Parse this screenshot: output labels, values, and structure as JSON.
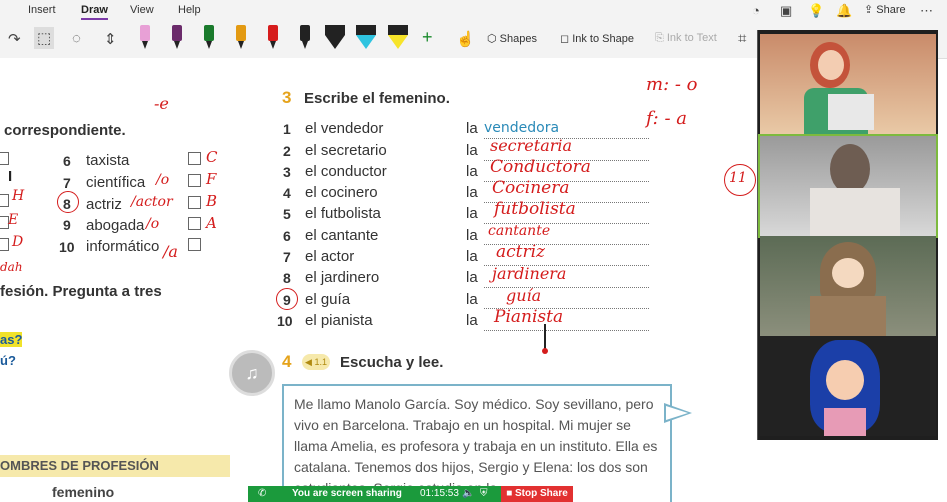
{
  "ribbon": {
    "tabs": [
      "Insert",
      "Draw",
      "View",
      "Help"
    ],
    "active_tab": "Draw",
    "share_label": "Share"
  },
  "toolbar": {
    "shapes_label": "Shapes",
    "ink_to_shape_label": "Ink to Shape",
    "ink_to_text_label": "Ink to Text",
    "pen_colors": [
      "#e8a0d6",
      "#6b2b6b",
      "#1a7a2c",
      "#e39a12",
      "#d61c1c",
      "#222222"
    ],
    "highlighter_colors": [
      "#222222",
      "#2fc4e0",
      "#f7e42a"
    ]
  },
  "page": {
    "left_heading": "correspondiente.",
    "left_items": [
      {
        "num": "6",
        "word": "taxista",
        "handwriting": "C"
      },
      {
        "num": "7",
        "word": "científica",
        "handwriting": "F"
      },
      {
        "num": "8",
        "word": "actriz",
        "handwriting": "B"
      },
      {
        "num": "9",
        "word": "abogada",
        "handwriting": "A"
      },
      {
        "num": "10",
        "word": "informático",
        "handwriting": ""
      }
    ],
    "left_notes": [
      "/o",
      "/actor",
      "/o",
      "/a"
    ],
    "left_margin_marks": [
      "I",
      "H",
      "E",
      "D",
      "dah"
    ],
    "profesion_prompt": "fesión. Pregunta a tres",
    "side_yellow_1": "as?",
    "side_yellow_2": "ú?",
    "prof_heading": "OMBRES DE PROFESIÓN",
    "prof_sub": "femenino",
    "exercise3_number": "3",
    "exercise3_title": "Escribe el femenino.",
    "exercise3": [
      {
        "num": "1",
        "word": "el vendedor",
        "art": "la",
        "answer": "vendedora"
      },
      {
        "num": "2",
        "word": "el secretario",
        "art": "la",
        "answer": "secretaria"
      },
      {
        "num": "3",
        "word": "el conductor",
        "art": "la",
        "answer": "Conductora"
      },
      {
        "num": "4",
        "word": "el cocinero",
        "art": "la",
        "answer": "Cocinera"
      },
      {
        "num": "5",
        "word": "el futbolista",
        "art": "la",
        "answer": "futbolista"
      },
      {
        "num": "6",
        "word": "el cantante",
        "art": "la",
        "answer": "cantante"
      },
      {
        "num": "7",
        "word": "el actor",
        "art": "la",
        "answer": "actriz"
      },
      {
        "num": "8",
        "word": "el jardinero",
        "art": "la",
        "answer": "jardinera"
      },
      {
        "num": "9",
        "word": "el guía",
        "art": "la",
        "answer": "guía"
      },
      {
        "num": "10",
        "word": "el pianista",
        "art": "la",
        "answer": "Pianista"
      }
    ],
    "exercise4_number": "4",
    "exercise4_track": "1.1",
    "exercise4_title": "Escucha y lee.",
    "reading_text": "Me llamo Manolo García. Soy médico. Soy sevillano, pero vivo en Barcelona. Trabajo en un hospital. Mi mujer se llama Amelia, es profesora y trabaja en un instituto. Ella es catalana. Tenemos dos hijos, Sergio y Elena: los dos son estudiantes. Sergio estudia en la",
    "notes_right": {
      "m": "m: - o",
      "f": "f: - a",
      "circled": "11",
      "top_left": "-e"
    }
  },
  "sharing": {
    "status": "You are screen sharing",
    "time": "01:15:53",
    "stop_label": "Stop Share"
  }
}
